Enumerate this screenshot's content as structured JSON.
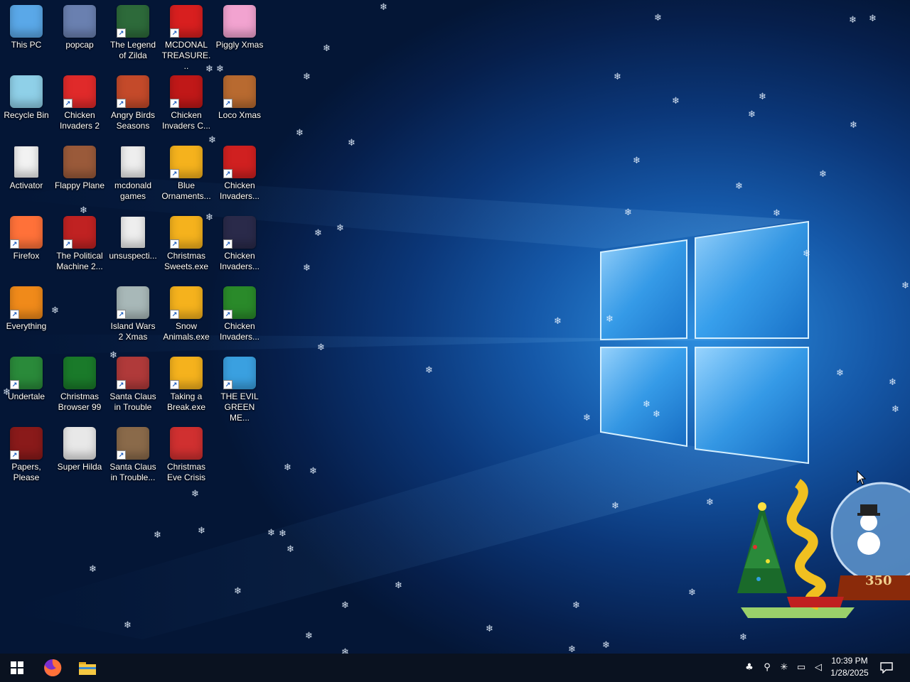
{
  "desktop": {
    "icons": [
      {
        "label": "This PC",
        "icon": "this-pc-icon",
        "shortcut": false,
        "color": "#5aa8e8"
      },
      {
        "label": "popcap",
        "icon": "popcap-folder-icon",
        "shortcut": false,
        "color": "#6a80b0"
      },
      {
        "label": "The Legend of Zilda",
        "icon": "legend-of-zilda-icon",
        "shortcut": true,
        "color": "#2d6a3a"
      },
      {
        "label": "MCDONAL TREASURE...",
        "icon": "mcdonalds-treasure-icon",
        "shortcut": true,
        "color": "#d81f1f"
      },
      {
        "label": "Piggly Xmas",
        "icon": "piggly-xmas-icon",
        "shortcut": false,
        "color": "#f2a3d0"
      },
      {
        "label": "Recycle Bin",
        "icon": "recycle-bin-icon",
        "shortcut": false,
        "color": "#8fd0e8"
      },
      {
        "label": "Chicken Invaders 2",
        "icon": "chicken-invaders-2-icon",
        "shortcut": true,
        "color": "#e02a2a"
      },
      {
        "label": "Angry Birds Seasons",
        "icon": "angry-birds-seasons-icon",
        "shortcut": true,
        "color": "#c44a2a"
      },
      {
        "label": "Chicken Invaders C...",
        "icon": "chicken-invaders-c-icon",
        "shortcut": true,
        "color": "#c01818"
      },
      {
        "label": "Loco Xmas",
        "icon": "loco-xmas-icon",
        "shortcut": true,
        "color": "#b86a30"
      },
      {
        "label": "Activator",
        "icon": "activator-file-icon",
        "shortcut": false,
        "color": "#f2f2f2"
      },
      {
        "label": "Flappy Plane",
        "icon": "flappy-plane-icon",
        "shortcut": false,
        "color": "#9a5a3a"
      },
      {
        "label": "mcdonald games",
        "icon": "mcdonald-games-file-icon",
        "shortcut": false,
        "color": "#eeeeee"
      },
      {
        "label": "Blue Ornaments...",
        "icon": "blue-ornaments-icon",
        "shortcut": true,
        "color": "#f5b21d"
      },
      {
        "label": "Chicken Invaders...",
        "icon": "chicken-invaders-xmas-icon",
        "shortcut": true,
        "color": "#d02020"
      },
      {
        "label": "Firefox",
        "icon": "firefox-icon",
        "shortcut": true,
        "color": "#ff7139"
      },
      {
        "label": "The Political Machine 2...",
        "icon": "political-machine-icon",
        "shortcut": true,
        "color": "#c02222"
      },
      {
        "label": "unsuspecti...",
        "icon": "unsuspecti-file-icon",
        "shortcut": false,
        "color": "#eeeeee"
      },
      {
        "label": "Christmas Sweets.exe",
        "icon": "christmas-sweets-icon",
        "shortcut": true,
        "color": "#f5b21d"
      },
      {
        "label": "Chicken Invaders...",
        "icon": "chicken-invaders-space-icon",
        "shortcut": true,
        "color": "#2a2a4a"
      },
      {
        "label": "Everything",
        "icon": "everything-search-icon",
        "shortcut": true,
        "color": "#f08a1a"
      },
      {
        "label": "Island Wars 2 Xmas",
        "icon": "island-wars-icon",
        "shortcut": true,
        "color": "#a8b8b8"
      },
      {
        "label": "Snow Animals.exe",
        "icon": "snow-animals-icon",
        "shortcut": true,
        "color": "#f5b21d"
      },
      {
        "label": "Chicken Invaders...",
        "icon": "chicken-invaders-green-icon",
        "shortcut": true,
        "color": "#2a8a2a"
      },
      {
        "label": "Undertale",
        "icon": "undertale-icon",
        "shortcut": true,
        "color": "#2a8a3a"
      },
      {
        "label": "Christmas Browser 99",
        "icon": "christmas-browser-99-icon",
        "shortcut": false,
        "color": "#1a7a2a"
      },
      {
        "label": "Santa Claus in Trouble",
        "icon": "santa-claus-in-trouble-icon",
        "shortcut": true,
        "color": "#b03a3a"
      },
      {
        "label": "Taking a Break.exe",
        "icon": "taking-a-break-icon",
        "shortcut": true,
        "color": "#f5b21d"
      },
      {
        "label": "THE EVIL GREEN ME...",
        "icon": "evil-green-messenger-icon",
        "shortcut": true,
        "color": "#3aa0e0"
      },
      {
        "label": "Papers, Please",
        "icon": "papers-please-icon",
        "shortcut": true,
        "color": "#8a1a1a"
      },
      {
        "label": "Super Hilda",
        "icon": "super-hilda-icon",
        "shortcut": false,
        "color": "#e8e8e8"
      },
      {
        "label": "Santa Claus in Trouble...",
        "icon": "santa-claus-in-trouble-2-icon",
        "shortcut": true,
        "color": "#8a6a4a"
      },
      {
        "label": "Christmas Eve Crisis",
        "icon": "christmas-eve-crisis-icon",
        "shortcut": false,
        "color": "#d03030"
      }
    ]
  },
  "widget": {
    "counter": "350",
    "icon": "snow-globe-widget-icon"
  },
  "taskbar": {
    "start_icon": "windows-start-icon",
    "pinned": [
      {
        "name": "firefox-taskbar-icon"
      },
      {
        "name": "file-explorer-taskbar-icon"
      }
    ],
    "tray": [
      {
        "name": "network-people-tray-icon",
        "glyph": "♣"
      },
      {
        "name": "search-tray-icon",
        "glyph": "⚲"
      },
      {
        "name": "snowflake-tray-icon",
        "glyph": "✳"
      },
      {
        "name": "display-tray-icon",
        "glyph": "▭"
      },
      {
        "name": "volume-muted-tray-icon",
        "glyph": "◁"
      }
    ],
    "clock": {
      "time": "10:39 PM",
      "date": "1/28/2025"
    },
    "notification_icon": "action-center-icon"
  },
  "colors": {
    "taskbar_bg": "#0a1220",
    "desktop_glow": "#2d8fe0",
    "desktop_dark": "#041636"
  }
}
